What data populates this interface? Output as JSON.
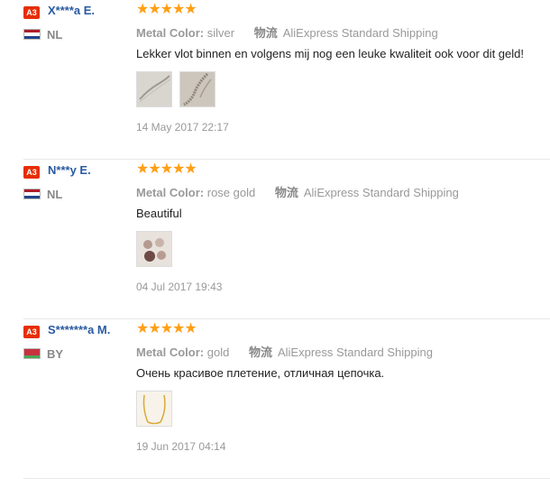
{
  "reviews": [
    {
      "badge": "A3",
      "user": "X****a E.",
      "country": "NL",
      "flag_colors": [
        "#ae1c28",
        "#ffffff",
        "#21468b"
      ],
      "rating": 5,
      "metal_label": "Metal Color:",
      "metal_value": "silver",
      "ship_cn": "物流",
      "ship_value": "AliExpress Standard Shipping",
      "text": "Lekker vlot binnen en volgens mij nog een leuke kwaliteit ook voor dit geld!",
      "date": "14 May 2017 22:17",
      "photos": [
        "silver chain photo",
        "silver chain close-up photo"
      ]
    },
    {
      "badge": "A3",
      "user": "N***y E.",
      "country": "NL",
      "flag_colors": [
        "#ae1c28",
        "#ffffff",
        "#21468b"
      ],
      "rating": 5,
      "metal_label": "Metal Color:",
      "metal_value": "rose gold",
      "ship_cn": "物流",
      "ship_value": "AliExpress Standard Shipping",
      "text": "Beautiful",
      "date": "04 Jul 2017 19:43",
      "photos": [
        "rose gold necklace photo"
      ]
    },
    {
      "badge": "A3",
      "user": "S*******a M.",
      "country": "BY",
      "flag_colors": [
        "#c8313e",
        "#4aa657"
      ],
      "rating": 5,
      "metal_label": "Metal Color:",
      "metal_value": "gold",
      "ship_cn": "物流",
      "ship_value": "AliExpress Standard Shipping",
      "text": "Очень красивое плетение, отличная цепочка.",
      "date": "19 Jun 2017 04:14",
      "photos": [
        "gold chain photo"
      ]
    }
  ],
  "colors": {
    "star": "#ff9e16",
    "badge": "#e62e04",
    "user_link": "#2a5aa0"
  }
}
